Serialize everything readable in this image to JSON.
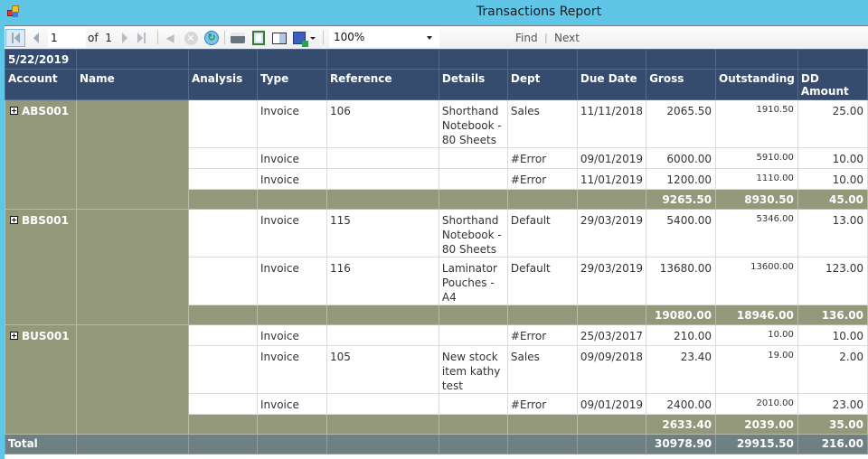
{
  "window": {
    "title": "Transactions Report"
  },
  "toolbar": {
    "current_page": "1",
    "of_label": "of",
    "total_pages": "1",
    "zoom": "100%",
    "find_label": "Find",
    "next_label": "Next",
    "icons": [
      "first-page-icon",
      "previous-page-icon",
      "next-page-icon",
      "last-page-icon",
      "back-icon",
      "stop-icon",
      "refresh-icon",
      "print-icon",
      "print-layout-icon",
      "page-setup-icon",
      "export-icon"
    ]
  },
  "report": {
    "date": "5/22/2019",
    "columns": [
      "Account",
      "Name",
      "Analysis",
      "Type",
      "Reference",
      "Details",
      "Dept",
      "Due Date",
      "Gross",
      "Outstanding",
      "DD Amount"
    ],
    "groups": [
      {
        "account": "ABS001",
        "rows": [
          {
            "type": "Invoice",
            "reference": "106",
            "details": "Shorthand Notebook - 80 Sheets",
            "dept": "Sales",
            "due_date": "11/11/2018",
            "gross": "2065.50",
            "outstanding": "1910.50",
            "dd_amount": "25.00"
          },
          {
            "type": "Invoice",
            "reference": "",
            "details": "",
            "dept": "#Error",
            "due_date": "09/01/2019",
            "gross": "6000.00",
            "outstanding": "5910.00",
            "dd_amount": "10.00"
          },
          {
            "type": "Invoice",
            "reference": "",
            "details": "",
            "dept": "#Error",
            "due_date": "11/01/2019",
            "gross": "1200.00",
            "outstanding": "1110.00",
            "dd_amount": "10.00"
          }
        ],
        "subtotal": {
          "gross": "9265.50",
          "outstanding": "8930.50",
          "dd_amount": "45.00"
        }
      },
      {
        "account": "BBS001",
        "rows": [
          {
            "type": "Invoice",
            "reference": "115",
            "details": "Shorthand Notebook - 80 Sheets",
            "dept": "Default",
            "due_date": "29/03/2019",
            "gross": "5400.00",
            "outstanding": "5346.00",
            "dd_amount": "13.00"
          },
          {
            "type": "Invoice",
            "reference": "116",
            "details": "Laminator Pouches - A4",
            "dept": "Default",
            "due_date": "29/03/2019",
            "gross": "13680.00",
            "outstanding": "13600.00",
            "dd_amount": "123.00"
          }
        ],
        "subtotal": {
          "gross": "19080.00",
          "outstanding": "18946.00",
          "dd_amount": "136.00"
        }
      },
      {
        "account": "BUS001",
        "rows": [
          {
            "type": "Invoice",
            "reference": "",
            "details": "",
            "dept": "#Error",
            "due_date": "25/03/2017",
            "gross": "210.00",
            "outstanding": "10.00",
            "dd_amount": "10.00"
          },
          {
            "type": "Invoice",
            "reference": "105",
            "details": "New stock item kathy test",
            "dept": "Sales",
            "due_date": "09/09/2018",
            "gross": "23.40",
            "outstanding": "19.00",
            "dd_amount": "2.00"
          },
          {
            "type": "Invoice",
            "reference": "",
            "details": "",
            "dept": "#Error",
            "due_date": "09/01/2019",
            "gross": "2400.00",
            "outstanding": "2010.00",
            "dd_amount": "23.00"
          }
        ],
        "subtotal": {
          "gross": "2633.40",
          "outstanding": "2039.00",
          "dd_amount": "35.00"
        }
      }
    ],
    "total": {
      "label": "Total",
      "gross": "30978.90",
      "outstanding": "29915.50",
      "dd_amount": "216.00"
    }
  }
}
